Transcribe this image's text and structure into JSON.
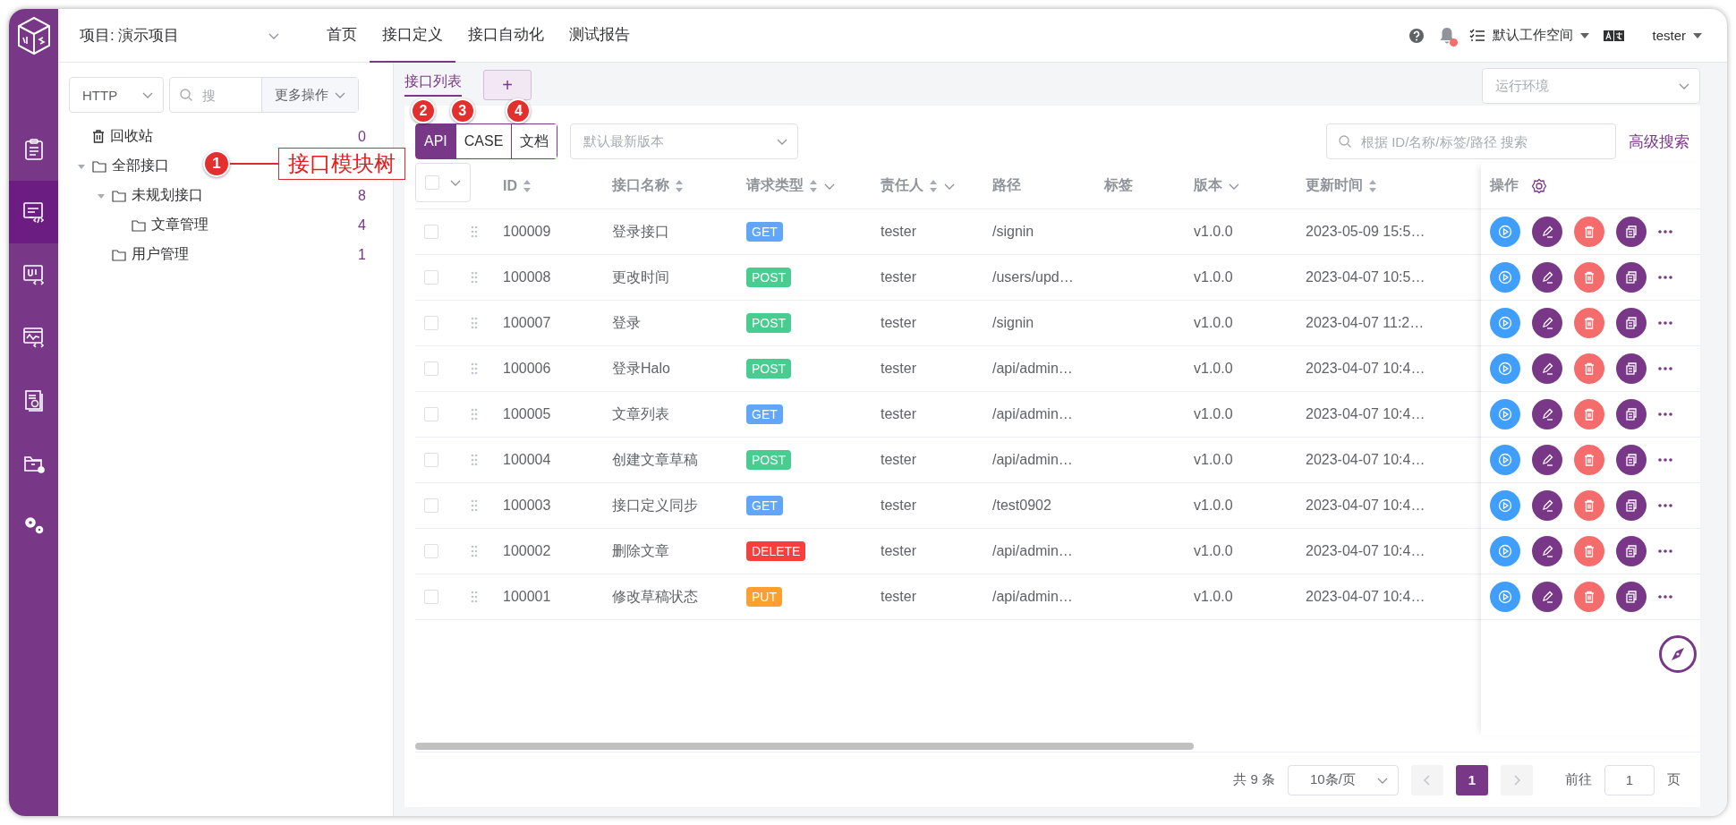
{
  "sidebar": {
    "items": [
      {
        "kind": "project",
        "selected": false
      },
      {
        "kind": "api",
        "selected": true
      },
      {
        "kind": "ui",
        "selected": false
      },
      {
        "kind": "performance",
        "selected": false
      },
      {
        "kind": "report",
        "selected": false
      },
      {
        "kind": "workspace",
        "selected": false
      },
      {
        "kind": "settings",
        "selected": false
      }
    ]
  },
  "header": {
    "project": "项目: 演示项目",
    "nav": [
      {
        "label": "首页",
        "selected": false
      },
      {
        "label": "接口定义",
        "selected": true
      },
      {
        "label": "接口自动化",
        "selected": false
      },
      {
        "label": "测试报告",
        "selected": false
      }
    ],
    "unread": true,
    "workspace": "默认工作空间",
    "user": "tester"
  },
  "module_panel": {
    "protocol": "HTTP",
    "search_placeholder": "搜",
    "more_actions": "更多操作",
    "trash": {
      "label": "回收站",
      "count": "0"
    },
    "tree": [
      {
        "label": "全部接口",
        "expanded": true,
        "annotation": {
          "number": "1",
          "callout": "接口模块树"
        },
        "children": [
          {
            "label": "未规划接口",
            "count": "8",
            "expanded": true,
            "children": [
              {
                "label": "文章管理",
                "count": "4"
              }
            ]
          },
          {
            "label": "用户管理",
            "count": "1"
          }
        ]
      }
    ]
  },
  "content": {
    "tabs": [
      {
        "label": "接口列表",
        "selected": true
      }
    ],
    "add_tab": "+",
    "environment_placeholder": "运行环境",
    "view_modes": [
      {
        "label": "API",
        "selected": true,
        "annotation": "2"
      },
      {
        "label": "CASE",
        "selected": false,
        "annotation": "3"
      },
      {
        "label": "文档",
        "selected": false,
        "annotation": "4"
      }
    ],
    "version_placeholder": "默认最新版本",
    "search_placeholder": "根据 ID/名称/标签/路径 搜索",
    "advanced_search": "高级搜索",
    "table": {
      "all_selected": false,
      "columns": [
        {
          "label": "ID",
          "sortable": true,
          "filterable": false
        },
        {
          "label": "接口名称",
          "sortable": true,
          "filterable": false
        },
        {
          "label": "请求类型",
          "sortable": true,
          "filterable": true
        },
        {
          "label": "责任人",
          "sortable": true,
          "filterable": true
        },
        {
          "label": "路径",
          "sortable": false,
          "filterable": false
        },
        {
          "label": "标签",
          "sortable": false,
          "filterable": false
        },
        {
          "label": "版本",
          "sortable": false,
          "filterable": true
        },
        {
          "label": "更新时间",
          "sortable": true,
          "filterable": false
        }
      ],
      "actions_column": "操作",
      "rows": [
        {
          "selected": false,
          "id": "100009",
          "name": "登录接口",
          "method": {
            "label": "GET",
            "color": "#61a6f8"
          },
          "owner": "tester",
          "path": "/signin",
          "version": "v1.0.0",
          "updated": "2023-05-09 15:5…"
        },
        {
          "selected": false,
          "id": "100008",
          "name": "更改时间",
          "method": {
            "label": "POST",
            "color": "#49cc90"
          },
          "owner": "tester",
          "path": "/users/upd…",
          "version": "v1.0.0",
          "updated": "2023-04-07 10:5…"
        },
        {
          "selected": false,
          "id": "100007",
          "name": "登录",
          "method": {
            "label": "POST",
            "color": "#49cc90"
          },
          "owner": "tester",
          "path": "/signin",
          "version": "v1.0.0",
          "updated": "2023-04-07 11:2…"
        },
        {
          "selected": false,
          "id": "100006",
          "name": "登录Halo",
          "method": {
            "label": "POST",
            "color": "#49cc90"
          },
          "owner": "tester",
          "path": "/api/admin…",
          "version": "v1.0.0",
          "updated": "2023-04-07 10:4…"
        },
        {
          "selected": false,
          "id": "100005",
          "name": "文章列表",
          "method": {
            "label": "GET",
            "color": "#61a6f8"
          },
          "owner": "tester",
          "path": "/api/admin…",
          "version": "v1.0.0",
          "updated": "2023-04-07 10:4…"
        },
        {
          "selected": false,
          "id": "100004",
          "name": "创建文章草稿",
          "method": {
            "label": "POST",
            "color": "#49cc90"
          },
          "owner": "tester",
          "path": "/api/admin…",
          "version": "v1.0.0",
          "updated": "2023-04-07 10:4…"
        },
        {
          "selected": false,
          "id": "100003",
          "name": "接口定义同步",
          "method": {
            "label": "GET",
            "color": "#61a6f8"
          },
          "owner": "tester",
          "path": "/test0902",
          "version": "v1.0.0",
          "updated": "2023-04-07 10:4…"
        },
        {
          "selected": false,
          "id": "100002",
          "name": "删除文章",
          "method": {
            "label": "DELETE",
            "color": "#f93e3e"
          },
          "owner": "tester",
          "path": "/api/admin…",
          "version": "v1.0.0",
          "updated": "2023-04-07 10:4…"
        },
        {
          "selected": false,
          "id": "100001",
          "name": "修改草稿状态",
          "method": {
            "label": "PUT",
            "color": "#fca130"
          },
          "owner": "tester",
          "path": "/api/admin…",
          "version": "v1.0.0",
          "updated": "2023-04-07 10:4…"
        }
      ]
    },
    "pagination": {
      "total": "共 9 条",
      "page_size": "10条/页",
      "pages": [
        {
          "label": "1",
          "selected": true
        }
      ],
      "goto_label": "前往",
      "goto_value": "1",
      "goto_suffix": "页"
    }
  }
}
